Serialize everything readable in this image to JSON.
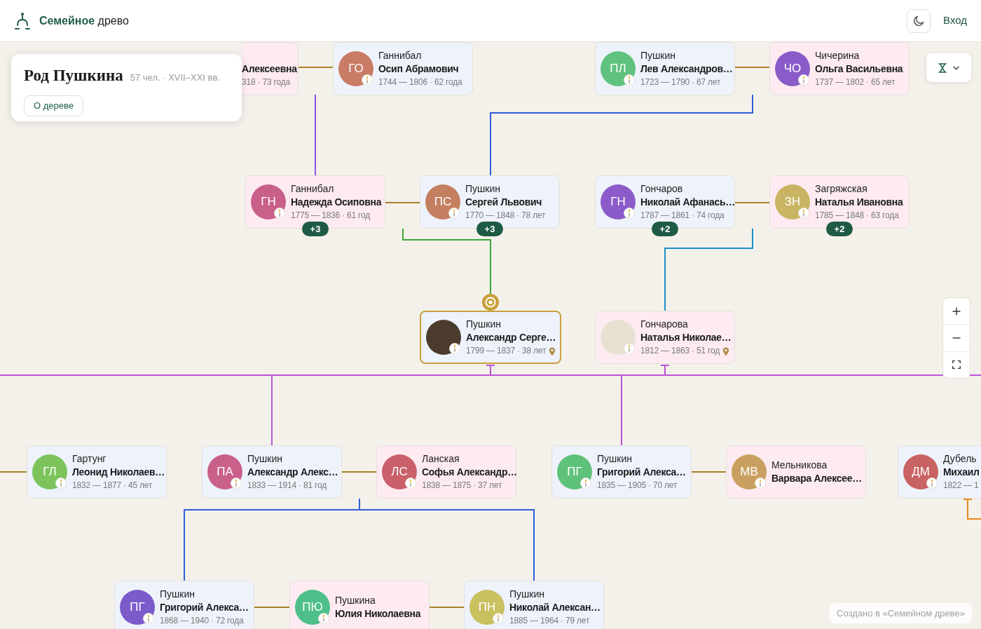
{
  "header": {
    "brand": "**Семейное** древо",
    "login": "Вход"
  },
  "tree_info": {
    "title": "Род Пушкина",
    "meta": "57 чел. · XVII–XXI вв.",
    "button": "О дереве"
  },
  "generations": [
    {
      "people": [
        {
          "kind": "covered",
          "female": true,
          "given_name": "Алексеевна",
          "dates": "318 · 73 года",
          "deceased": false,
          "selected": false,
          "place_marker": false
        },
        {
          "kind": "card",
          "female": false,
          "avatar": {
            "kind": "initials",
            "text": "ГО",
            "color": "#c97b66"
          },
          "surname": "Ганнибал",
          "given_name": "Осип Абрамович",
          "dates": "1744 — 1806 · 62 года",
          "deceased": true,
          "selected": false,
          "place_marker": false
        },
        {
          "kind": "card",
          "female": false,
          "avatar": {
            "kind": "initials",
            "text": "ПЛ",
            "color": "#5fc27f"
          },
          "surname": "Пушкин",
          "given_name": "Лев Александров…",
          "dates": "1723 — 1790 · 67 лет",
          "deceased": true,
          "selected": false,
          "place_marker": false
        },
        {
          "kind": "card",
          "female": true,
          "avatar": {
            "kind": "initials",
            "text": "ЧО",
            "color": "#8a5bc9"
          },
          "surname": "Чичерина",
          "given_name": "Ольга Васильевна",
          "dates": "1737 — 1802 · 65 лет",
          "deceased": true,
          "selected": false,
          "place_marker": false
        }
      ]
    },
    {
      "people": [
        {
          "kind": "card",
          "female": true,
          "avatar": {
            "kind": "initials",
            "text": "ГН",
            "color": "#c9608a"
          },
          "surname": "Ганнибал",
          "given_name": "Надежда Осиповна",
          "dates": "1775 — 1836 · 61 год",
          "deceased": true,
          "selected": false,
          "place_marker": false,
          "more": "+3"
        },
        {
          "kind": "card",
          "female": false,
          "avatar": {
            "kind": "initials",
            "text": "ПС",
            "color": "#c47f60"
          },
          "surname": "Пушкин",
          "given_name": "Сергей Львович",
          "dates": "1770 — 1848 · 78 лет",
          "deceased": true,
          "selected": false,
          "place_marker": false,
          "more": "+3"
        },
        {
          "kind": "card",
          "female": false,
          "avatar": {
            "kind": "initials",
            "text": "ГН",
            "color": "#8a5bc9"
          },
          "surname": "Гончаров",
          "given_name": "Николай Афанась…",
          "dates": "1787 — 1861 · 74 года",
          "deceased": true,
          "selected": false,
          "place_marker": false,
          "more": "+2"
        },
        {
          "kind": "card",
          "female": true,
          "avatar": {
            "kind": "initials",
            "text": "ЗН",
            "color": "#c9b463"
          },
          "surname": "Загряжская",
          "given_name": "Наталья Ивановна",
          "dates": "1785 — 1848 · 63 года",
          "deceased": true,
          "selected": false,
          "place_marker": false,
          "more": "+2"
        }
      ]
    },
    {
      "people": [
        {
          "kind": "card",
          "female": false,
          "avatar": {
            "kind": "photo",
            "color": "#4b3b2d"
          },
          "surname": "Пушкин",
          "given_name": "Александр Серге…",
          "dates": "1799 — 1837 · 38 лет",
          "deceased": true,
          "selected": true,
          "place_marker": true
        },
        {
          "kind": "card",
          "female": true,
          "avatar": {
            "kind": "photo",
            "color": "#e8e1d2"
          },
          "surname": "Гончарова",
          "given_name": "Наталья Николае…",
          "dates": "1812 — 1863 · 51 год",
          "deceased": true,
          "selected": false,
          "place_marker": true
        }
      ]
    },
    {
      "people": [
        {
          "kind": "card",
          "female": false,
          "avatar": {
            "kind": "initials",
            "text": "ГЛ",
            "color": "#7cc35c"
          },
          "surname": "Гартунг",
          "given_name": "Леонид Николаев…",
          "dates": "1832 — 1877 · 45 лет",
          "deceased": true,
          "selected": false,
          "place_marker": false
        },
        {
          "kind": "card",
          "female": false,
          "avatar": {
            "kind": "initials",
            "text": "ПА",
            "color": "#c9608a"
          },
          "surname": "Пушкин",
          "given_name": "Александр Алекс…",
          "dates": "1833 — 1914 · 81 год",
          "deceased": true,
          "selected": false,
          "place_marker": false
        },
        {
          "kind": "card",
          "female": true,
          "avatar": {
            "kind": "initials",
            "text": "ЛС",
            "color": "#c9606a"
          },
          "surname": "Ланская",
          "given_name": "Софья Александр…",
          "dates": "1838 — 1875 · 37 лет",
          "deceased": true,
          "selected": false,
          "place_marker": false
        },
        {
          "kind": "card",
          "female": false,
          "avatar": {
            "kind": "initials",
            "text": "ПГ",
            "color": "#5fc27a"
          },
          "surname": "Пушкин",
          "given_name": "Григорий Алекса…",
          "dates": "1835 — 1905 · 70 лет",
          "deceased": true,
          "selected": false,
          "place_marker": false
        },
        {
          "kind": "card",
          "female": true,
          "avatar": {
            "kind": "initials",
            "text": "МВ",
            "color": "#c9a060"
          },
          "surname": "Мельникова",
          "given_name": "Варвара Алексее…",
          "deceased": true,
          "selected": false,
          "place_marker": false
        },
        {
          "kind": "card",
          "female": false,
          "avatar": {
            "kind": "initials",
            "text": "ДМ",
            "color": "#c96262"
          },
          "surname": "Дубель",
          "given_name": "Михаил",
          "dates": "1822 — 1",
          "deceased": true,
          "selected": false,
          "place_marker": false
        }
      ]
    },
    {
      "people": [
        {
          "kind": "card",
          "female": false,
          "avatar": {
            "kind": "initials",
            "text": "ПГ",
            "color": "#7a5bc9"
          },
          "surname": "Пушкин",
          "given_name": "Григорий Алекса…",
          "dates": "1868 — 1940 · 72 года",
          "deceased": true,
          "selected": false,
          "place_marker": false
        },
        {
          "kind": "card",
          "female": true,
          "avatar": {
            "kind": "initials",
            "text": "ПЮ",
            "color": "#4fbf8a"
          },
          "surname": "Пушкина",
          "given_name": "Юлия Николаевна",
          "deceased": true,
          "selected": false,
          "place_marker": false
        },
        {
          "kind": "card",
          "female": false,
          "avatar": {
            "kind": "initials",
            "text": "ПН",
            "color": "#c9c060"
          },
          "surname": "Пушкин",
          "given_name": "Николай Алексан…",
          "dates": "1885 — 1964 · 79 лет",
          "deceased": true,
          "selected": false,
          "place_marker": false
        }
      ]
    }
  ],
  "credit": "Создано в «Семейном древе»"
}
